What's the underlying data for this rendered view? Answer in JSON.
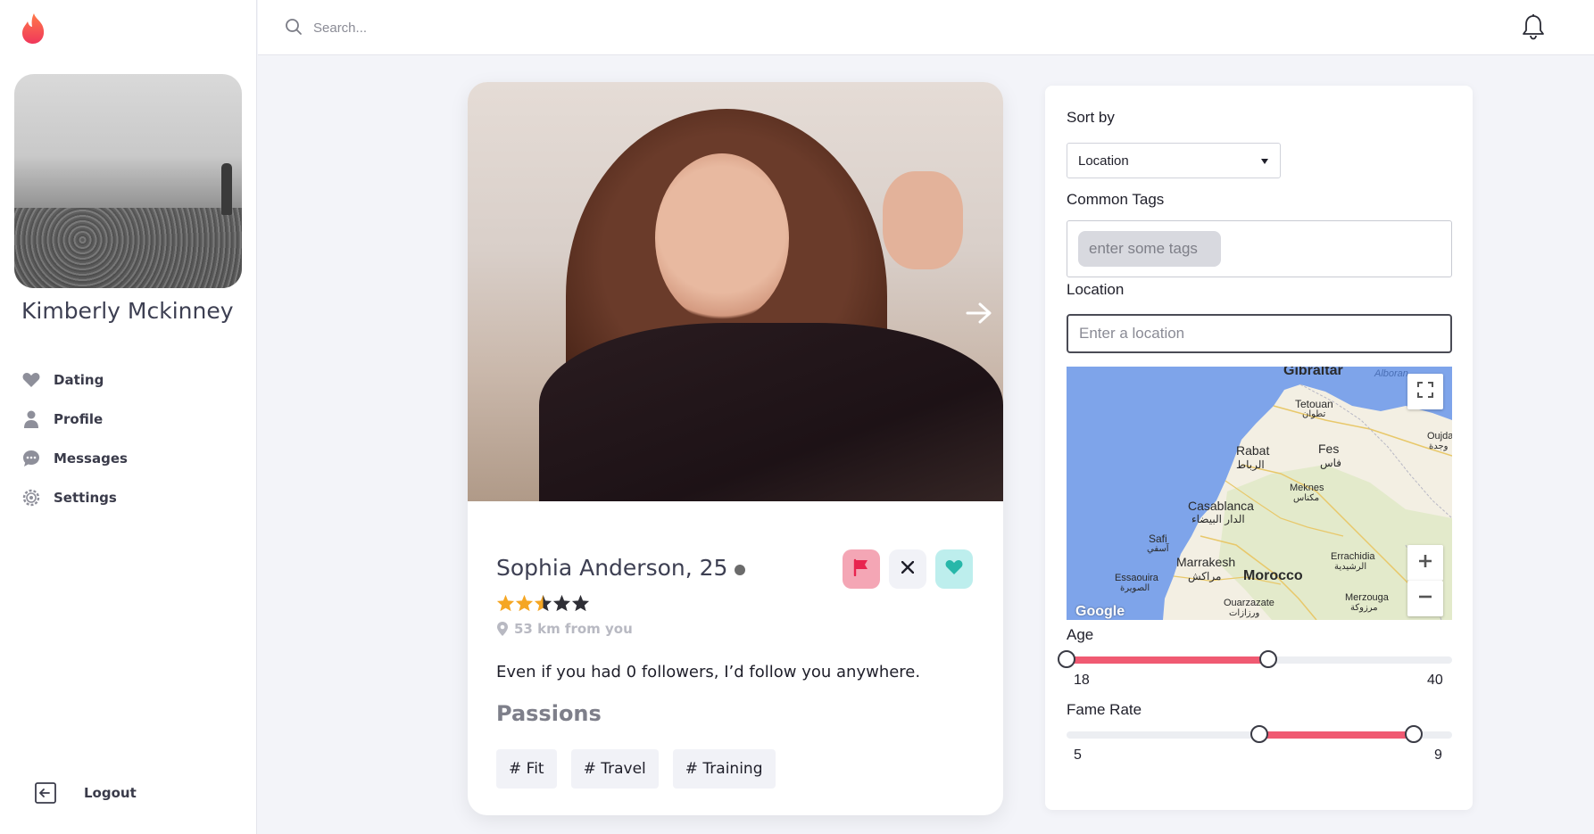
{
  "brand": {
    "logo_icon": "flame-icon",
    "accent": "#f05a72"
  },
  "user": {
    "name": "Kimberly Mckinney"
  },
  "nav": [
    {
      "label": "Dating",
      "icon": "heart-icon"
    },
    {
      "label": "Profile",
      "icon": "person-icon"
    },
    {
      "label": "Messages",
      "icon": "chat-icon"
    },
    {
      "label": "Settings",
      "icon": "gear-icon"
    }
  ],
  "logout": {
    "label": "Logout",
    "icon": "logout-icon"
  },
  "search": {
    "placeholder": "Search..."
  },
  "profile": {
    "name_age": "Sophia Anderson, 25",
    "rating": 2.5,
    "rating_max": 5,
    "distance": "53 km from you",
    "bio": "Even if you had 0 followers, I’d follow you anywhere.",
    "passions_title": "Passions",
    "passions": [
      "# Fit",
      "# Travel",
      "# Training"
    ]
  },
  "filters": {
    "sort_label": "Sort by",
    "sort_value": "Location",
    "tags_label": "Common Tags",
    "tags_placeholder": "enter some tags",
    "location_label": "Location",
    "location_placeholder": "Enter a location",
    "map": {
      "labels": {
        "gibraltar": "Gibraltar",
        "alboran": "Alboran",
        "tetouan": "Tetouan",
        "tetouan_ar": "تطوان",
        "rabat": "Rabat",
        "rabat_ar": "الرباط",
        "fes": "Fes",
        "fes_ar": "فاس",
        "oujda": "Oujda",
        "oujda_ar": "وجدة",
        "meknes": "Meknes",
        "meknes_ar": "مكناس",
        "casablanca": "Casablanca",
        "casablanca_ar": "الدار البيضاء",
        "safi": "Safi",
        "safi_ar": "آسفي",
        "marrakesh": "Marrakesh",
        "marrakesh_ar": "مراكش",
        "morocco": "Morocco",
        "essaouira": "Essaouira",
        "essaouira_ar": "الصويرة",
        "errachidia": "Errachidia",
        "errachidia_ar": "الرشيدية",
        "ouarzazate": "Ouarzazate",
        "ouarzazate_ar": "ورزازات",
        "merzouga": "Merzouga",
        "merzouga_ar": "مرزوكة",
        "google": "Google"
      }
    },
    "age": {
      "label": "Age",
      "min": 18,
      "max": 40,
      "range_min": 18,
      "range_max": 60
    },
    "fame": {
      "label": "Fame Rate",
      "min": 5,
      "max": 9,
      "range_min": 0,
      "range_max": 10
    }
  }
}
